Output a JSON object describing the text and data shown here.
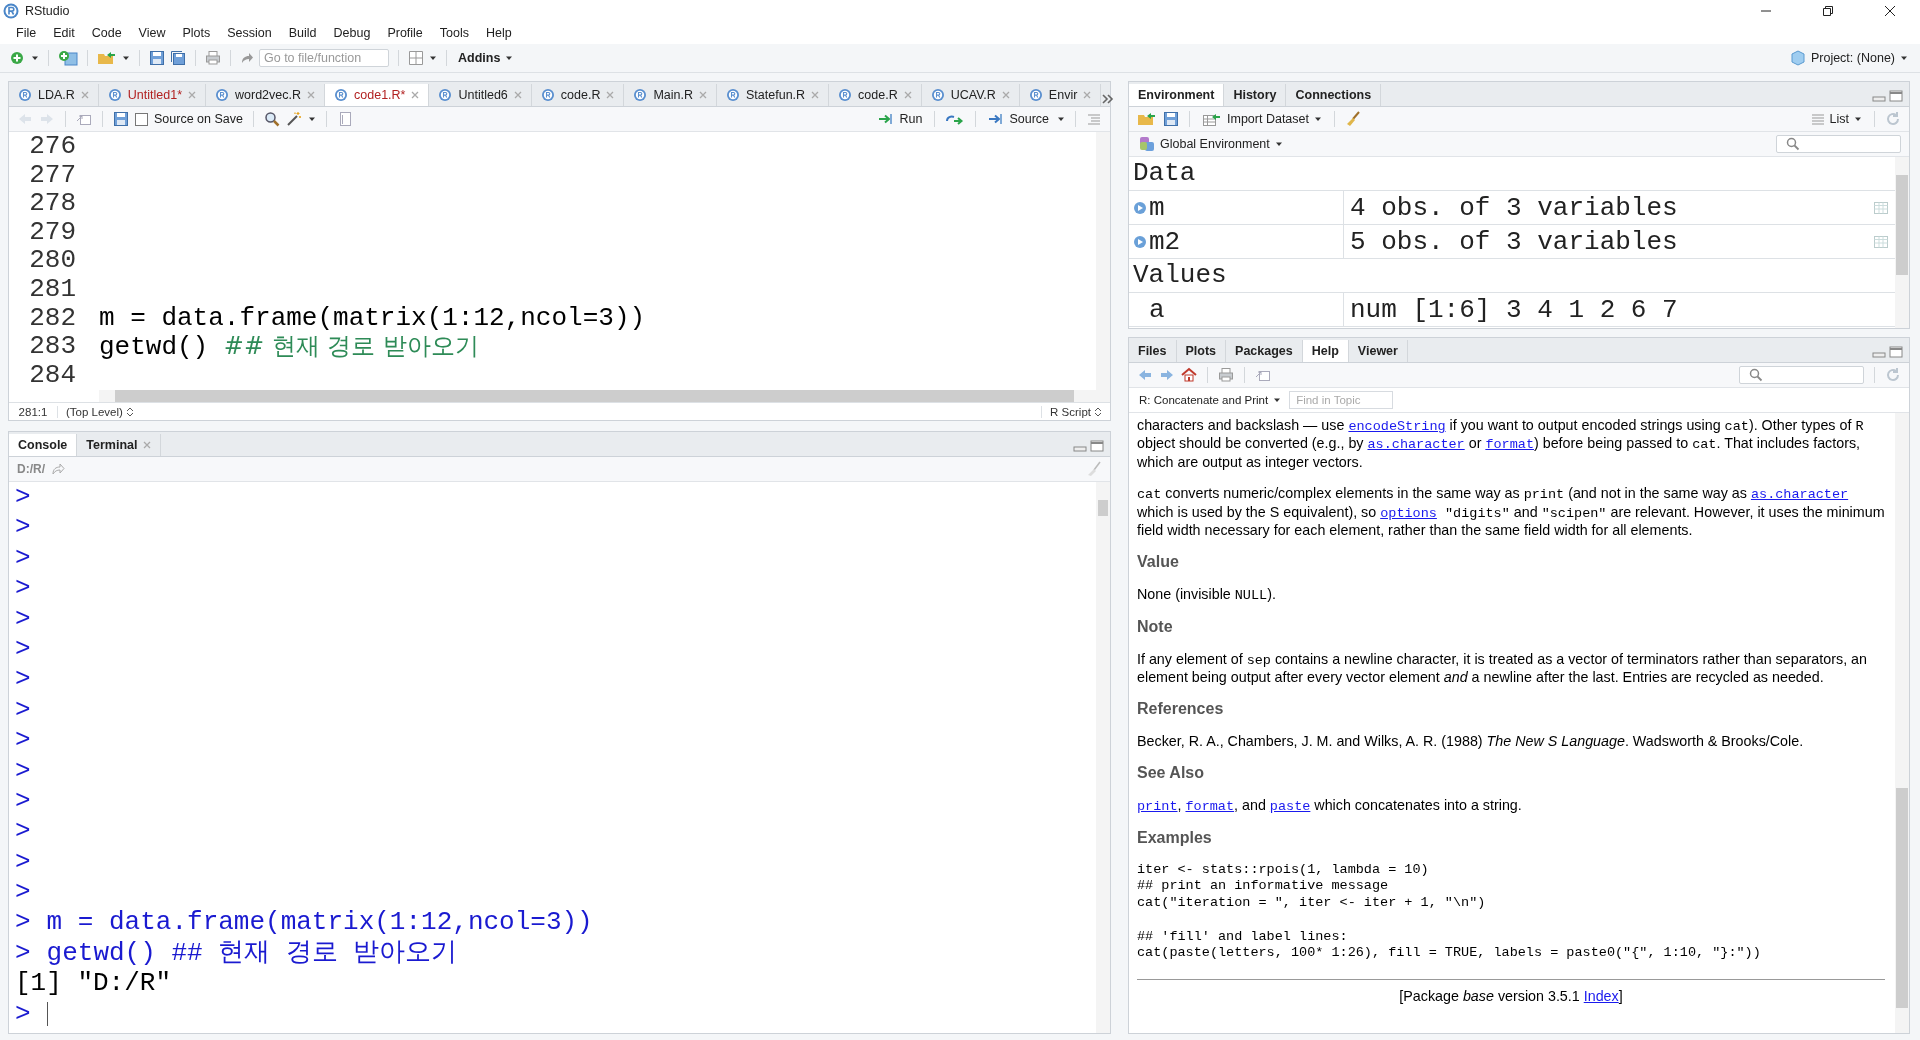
{
  "window": {
    "title": "RStudio"
  },
  "menu": [
    "File",
    "Edit",
    "Code",
    "View",
    "Plots",
    "Session",
    "Build",
    "Debug",
    "Profile",
    "Tools",
    "Help"
  ],
  "toolbar": {
    "goto_placeholder": "Go to file/function",
    "addins": "Addins",
    "project": "Project: (None)"
  },
  "editor": {
    "tabs": [
      {
        "label": "LDA.R",
        "selected": false,
        "modified": false
      },
      {
        "label": "Untitled1*",
        "selected": false,
        "modified": true
      },
      {
        "label": "word2vec.R",
        "selected": false,
        "modified": false
      },
      {
        "label": "code1.R*",
        "selected": true,
        "modified": true
      },
      {
        "label": "Untitled6",
        "selected": false,
        "modified": false
      },
      {
        "label": "code.R",
        "selected": false,
        "modified": false
      },
      {
        "label": "Main.R",
        "selected": false,
        "modified": false
      },
      {
        "label": "Statefun.R",
        "selected": false,
        "modified": false
      },
      {
        "label": "code.R",
        "selected": false,
        "modified": false
      },
      {
        "label": "UCAV.R",
        "selected": false,
        "modified": false
      },
      {
        "label": "Envir",
        "selected": false,
        "modified": false
      }
    ],
    "source_on_save": {
      "label": "Source on Save",
      "checked": false
    },
    "run": "Run",
    "source": "Source",
    "lines": [
      {
        "number": "276"
      },
      {
        "number": "277"
      },
      {
        "number": "278"
      },
      {
        "number": "279"
      },
      {
        "number": "280"
      },
      {
        "number": "281"
      },
      {
        "number": "282",
        "code": "m = data.frame(matrix(1:12,ncol=3))"
      },
      {
        "number": "283",
        "code": "getwd() ",
        "comment": "## 현재 경로 받아오기"
      },
      {
        "number": "284"
      }
    ],
    "status": {
      "position": "281:1",
      "scope": "(Top Level)",
      "type": "R Script"
    }
  },
  "console": {
    "tabs": [
      {
        "label": "Console",
        "selected": true,
        "closable": false
      },
      {
        "label": "Terminal",
        "selected": false,
        "closable": true
      }
    ],
    "path": "D:/R/",
    "lines": [
      {
        "kind": "input",
        "prompt": ">"
      },
      {
        "kind": "input",
        "prompt": ">"
      },
      {
        "kind": "input",
        "prompt": ">"
      },
      {
        "kind": "input",
        "prompt": ">"
      },
      {
        "kind": "input",
        "prompt": ">"
      },
      {
        "kind": "input",
        "prompt": ">"
      },
      {
        "kind": "input",
        "prompt": ">"
      },
      {
        "kind": "input",
        "prompt": ">"
      },
      {
        "kind": "input",
        "prompt": ">"
      },
      {
        "kind": "input",
        "prompt": ">"
      },
      {
        "kind": "input",
        "prompt": ">"
      },
      {
        "kind": "input",
        "prompt": ">"
      },
      {
        "kind": "input",
        "prompt": ">"
      },
      {
        "kind": "input",
        "prompt": ">"
      },
      {
        "kind": "input",
        "prompt": ">",
        "text": "m = data.frame(matrix(1:12,ncol=3))"
      },
      {
        "kind": "input",
        "prompt": ">",
        "text": "getwd() ## 현재 경로 받아오기"
      },
      {
        "kind": "output",
        "text": "[1] \"D:/R\""
      },
      {
        "kind": "prompt",
        "prompt": ">"
      }
    ]
  },
  "environment": {
    "tabs": [
      {
        "label": "Environment",
        "selected": true
      },
      {
        "label": "History",
        "selected": false
      },
      {
        "label": "Connections",
        "selected": false
      }
    ],
    "import": "Import Dataset",
    "view": "List",
    "scope": "Global Environment",
    "sections": [
      {
        "title": "Data",
        "rows": [
          {
            "name": "m",
            "value": "4 obs. of 3 variables",
            "kind": "data"
          },
          {
            "name": "m2",
            "value": "5 obs. of 3 variables",
            "kind": "data"
          }
        ]
      },
      {
        "title": "Values",
        "rows": [
          {
            "name": "a",
            "value": "num [1:6] 3 4 1 2 6 7",
            "kind": "value"
          }
        ]
      }
    ]
  },
  "help": {
    "tabs": [
      {
        "label": "Files",
        "selected": false
      },
      {
        "label": "Plots",
        "selected": false
      },
      {
        "label": "Packages",
        "selected": false
      },
      {
        "label": "Help",
        "selected": true
      },
      {
        "label": "Viewer",
        "selected": false
      }
    ],
    "topic": "R: Concatenate and Print",
    "find_placeholder": "Find in Topic",
    "blocks": [
      {
        "kind": "para",
        "parts": [
          {
            "kind": "text",
            "text": "characters and backslash — use "
          },
          {
            "kind": "link",
            "text": "encodeString"
          },
          {
            "kind": "text",
            "text": " if you want to output encoded strings using "
          },
          {
            "kind": "code",
            "text": "cat"
          },
          {
            "kind": "text",
            "text": "). Other types of "
          },
          {
            "kind": "code",
            "text": "R"
          },
          {
            "kind": "text",
            "text": " object should be converted (e.g., by "
          },
          {
            "kind": "link",
            "text": "as.character"
          },
          {
            "kind": "text",
            "text": " or "
          },
          {
            "kind": "link",
            "text": "format"
          },
          {
            "kind": "text",
            "text": ") before being passed to "
          },
          {
            "kind": "code",
            "text": "cat"
          },
          {
            "kind": "text",
            "text": ". That includes factors, which are output as integer vectors."
          }
        ]
      },
      {
        "kind": "para",
        "parts": [
          {
            "kind": "code",
            "text": "cat"
          },
          {
            "kind": "text",
            "text": " converts numeric/complex elements in the same way as "
          },
          {
            "kind": "code",
            "text": "print"
          },
          {
            "kind": "text",
            "text": " (and not in the same way as "
          },
          {
            "kind": "link",
            "text": "as.character"
          },
          {
            "kind": "text",
            "text": " which is used by the S equivalent), so "
          },
          {
            "kind": "link",
            "text": "options"
          },
          {
            "kind": "code",
            "text": " \"digits\""
          },
          {
            "kind": "text",
            "text": " and "
          },
          {
            "kind": "code",
            "text": "\"scipen\""
          },
          {
            "kind": "text",
            "text": " are relevant. However, it uses the minimum field width necessary for each element, rather than the same field width for all elements."
          }
        ]
      },
      {
        "kind": "heading",
        "text": "Value"
      },
      {
        "kind": "para",
        "parts": [
          {
            "kind": "text",
            "text": "None (invisible "
          },
          {
            "kind": "code",
            "text": "NULL"
          },
          {
            "kind": "text",
            "text": ")."
          }
        ]
      },
      {
        "kind": "heading",
        "text": "Note"
      },
      {
        "kind": "para",
        "parts": [
          {
            "kind": "text",
            "text": "If any element of "
          },
          {
            "kind": "code",
            "text": "sep"
          },
          {
            "kind": "text",
            "text": " contains a newline character, it is treated as a vector of terminators rather than separators, an element being output after every vector element "
          },
          {
            "kind": "em",
            "text": "and"
          },
          {
            "kind": "text",
            "text": " a newline after the last. Entries are recycled as needed."
          }
        ]
      },
      {
        "kind": "heading",
        "text": "References"
      },
      {
        "kind": "para",
        "parts": [
          {
            "kind": "text",
            "text": "Becker, R. A., Chambers, J. M. and Wilks, A. R. (1988) "
          },
          {
            "kind": "em",
            "text": "The New S Language"
          },
          {
            "kind": "text",
            "text": ". Wadsworth & Brooks/Cole."
          }
        ]
      },
      {
        "kind": "heading",
        "text": "See Also"
      },
      {
        "kind": "para",
        "parts": [
          {
            "kind": "link",
            "text": "print"
          },
          {
            "kind": "text",
            "text": ", "
          },
          {
            "kind": "link",
            "text": "format"
          },
          {
            "kind": "text",
            "text": ", and "
          },
          {
            "kind": "link",
            "text": "paste"
          },
          {
            "kind": "text",
            "text": " which concatenates into a string."
          }
        ]
      },
      {
        "kind": "heading",
        "text": "Examples"
      },
      {
        "kind": "code",
        "lines": [
          "iter <- stats::rpois(1, lambda = 10)",
          "## print an informative message",
          "cat(\"iteration = \", iter <- iter + 1, \"\\n\")"
        ]
      },
      {
        "kind": "code",
        "lines": [
          "## 'fill' and label lines:",
          "cat(paste(letters, 100* 1:26), fill = TRUE, labels = paste0(\"{\", 1:10, \"}:\"))"
        ]
      },
      {
        "kind": "footer",
        "parts": [
          {
            "kind": "text",
            "text": "[Package "
          },
          {
            "kind": "em",
            "text": "base"
          },
          {
            "kind": "text",
            "text": " version 3.5.1 "
          },
          {
            "kind": "link",
            "text": "Index"
          },
          {
            "kind": "text",
            "text": "]"
          }
        ]
      }
    ]
  }
}
